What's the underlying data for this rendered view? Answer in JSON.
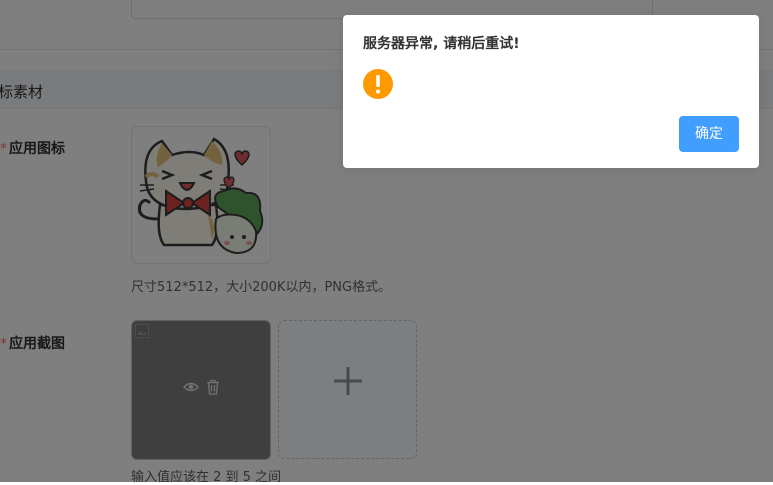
{
  "form": {
    "section_title": "标素材",
    "icon_field": {
      "required_mark": "*",
      "label": "应用图标",
      "tip": "尺寸512*512，大小200K以内，PNG格式。"
    },
    "screenshot_field": {
      "required_mark": "*",
      "label": "应用截图",
      "tip": "输入值应该在 2 到 5 之间"
    },
    "icons": {
      "preview": "eye-icon",
      "delete": "trash-icon",
      "upload": "plus-icon"
    }
  },
  "dialog": {
    "message": "服务器异常, 请稍后重试!",
    "icon": "warning-icon",
    "confirm_label": "确定",
    "accent_color": "#409eff",
    "warning_color": "#ff9900"
  }
}
